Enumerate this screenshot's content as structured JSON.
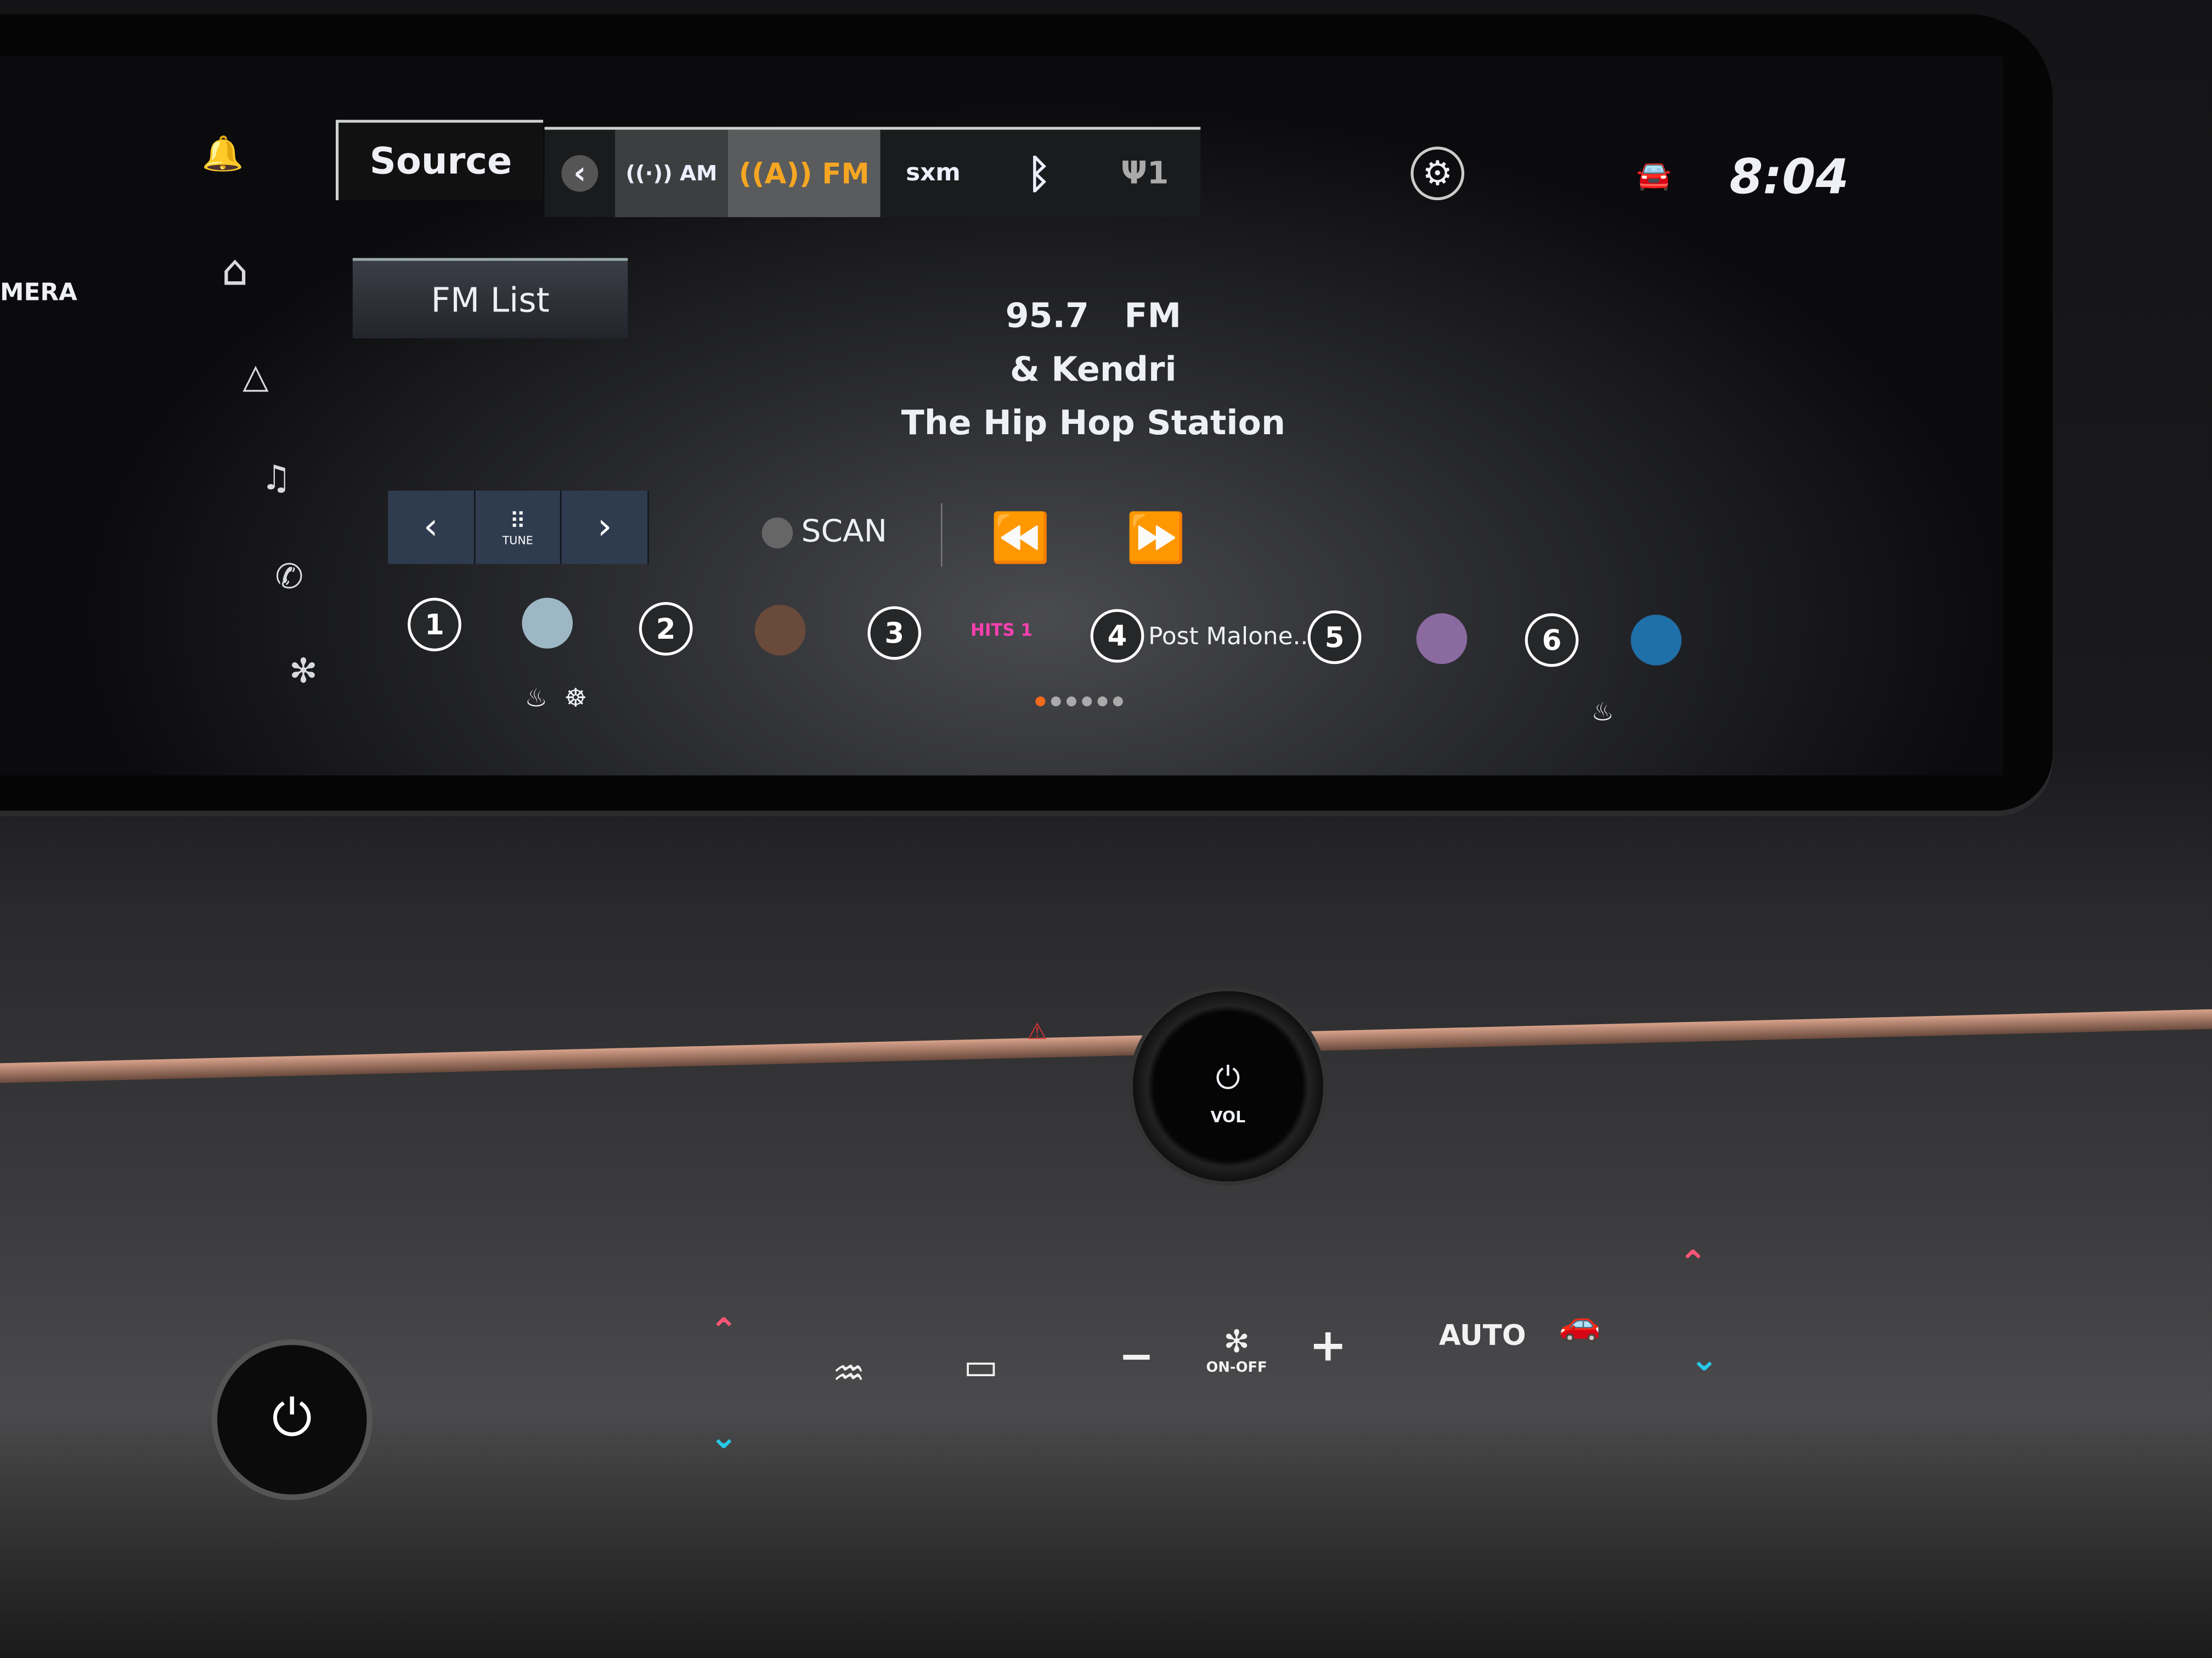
{
  "left_panel": {
    "camera_label": "MERA"
  },
  "sidebar": {
    "items": [
      {
        "icon": "bell-icon",
        "glyph": "🔔"
      },
      {
        "icon": "home-icon",
        "glyph": "⌂"
      },
      {
        "icon": "navigation-icon",
        "glyph": "△"
      },
      {
        "icon": "music-icon",
        "glyph": "♫"
      },
      {
        "icon": "phone-icon",
        "glyph": "✆"
      },
      {
        "icon": "fan-icon",
        "glyph": "✻"
      }
    ]
  },
  "header": {
    "source_label": "Source",
    "time": "8:04",
    "sources": [
      {
        "name": "back",
        "label": "‹"
      },
      {
        "name": "am",
        "label": "((·)) AM"
      },
      {
        "name": "fm",
        "label": "((A)) FM",
        "active": true
      },
      {
        "name": "sxm",
        "label": "sxm"
      },
      {
        "name": "bluetooth",
        "label": "ᛒ"
      },
      {
        "name": "usb",
        "label": "Ψ1"
      }
    ]
  },
  "accent_color": "#f5a623",
  "main": {
    "fm_list_label": "FM List",
    "frequency": "95.7",
    "band": "FM",
    "artist": "& Kendri",
    "station": "The Hip Hop Station",
    "scan_label": "SCAN",
    "tune_label": "TUNE",
    "tune_prev": "‹",
    "tune_next": "›",
    "rewind": "⏪",
    "fast_forward": "⏩"
  },
  "presets": [
    {
      "number": "1",
      "type": "art",
      "color": "#9db8c4"
    },
    {
      "number": "2",
      "type": "art",
      "color": "#6a4a3a"
    },
    {
      "number": "3",
      "type": "logo",
      "label": "HITS 1"
    },
    {
      "number": "4",
      "type": "text",
      "label": "Post Malone..."
    },
    {
      "number": "5",
      "type": "art",
      "color": "#8b6aa0"
    },
    {
      "number": "6",
      "type": "art",
      "color": "#1f6fa8"
    }
  ],
  "pagination": {
    "pages": 6,
    "current": 1
  },
  "console": {
    "vol_label": "VOL",
    "fan_label": "ON-OFF",
    "auto_label": "AUTO",
    "minus": "−",
    "plus": "+",
    "power": "⏻"
  }
}
